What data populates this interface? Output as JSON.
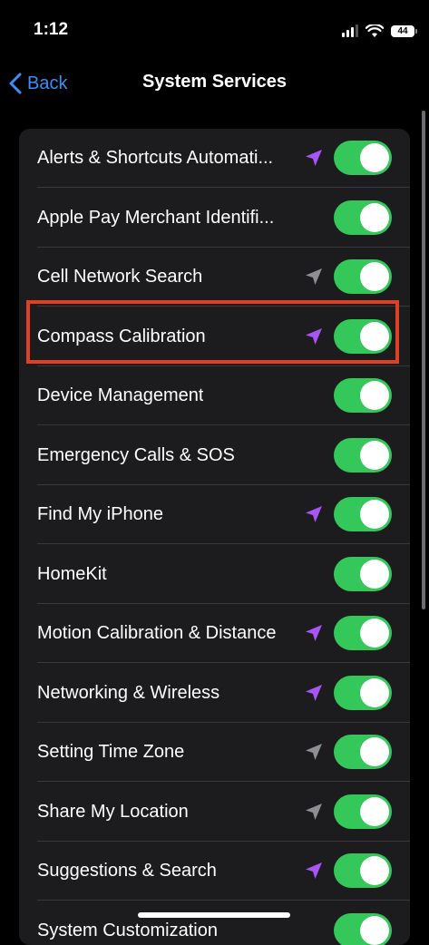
{
  "status_bar": {
    "time": "1:12",
    "battery_level": "44"
  },
  "nav": {
    "back_label": "Back",
    "title": "System Services"
  },
  "colors": {
    "toggle_on": "#34c759",
    "location_recent": "#a855f7",
    "location_past": "#8e8e93",
    "highlight": "#e0401f",
    "link": "#3a8ef6"
  },
  "services": [
    {
      "label": "Alerts & Shortcuts Automati...",
      "location_icon": "purple-location-arrow-icon",
      "enabled": true
    },
    {
      "label": "Apple Pay Merchant Identifi...",
      "location_icon": "",
      "enabled": true
    },
    {
      "label": "Cell Network Search",
      "location_icon": "gray-location-arrow-icon",
      "enabled": true
    },
    {
      "label": "Compass Calibration",
      "location_icon": "purple-location-arrow-icon",
      "enabled": true,
      "highlighted": true
    },
    {
      "label": "Device Management",
      "location_icon": "",
      "enabled": true
    },
    {
      "label": "Emergency Calls & SOS",
      "location_icon": "",
      "enabled": true
    },
    {
      "label": "Find My iPhone",
      "location_icon": "purple-location-arrow-icon",
      "enabled": true
    },
    {
      "label": "HomeKit",
      "location_icon": "",
      "enabled": true
    },
    {
      "label": "Motion Calibration & Distance",
      "location_icon": "purple-location-arrow-icon",
      "enabled": true
    },
    {
      "label": "Networking & Wireless",
      "location_icon": "purple-location-arrow-icon",
      "enabled": true
    },
    {
      "label": "Setting Time Zone",
      "location_icon": "gray-location-arrow-icon",
      "enabled": true
    },
    {
      "label": "Share My Location",
      "location_icon": "gray-location-arrow-icon",
      "enabled": true
    },
    {
      "label": "Suggestions & Search",
      "location_icon": "purple-location-arrow-icon",
      "enabled": true
    },
    {
      "label": "System Customization",
      "location_icon": "",
      "enabled": true
    }
  ]
}
